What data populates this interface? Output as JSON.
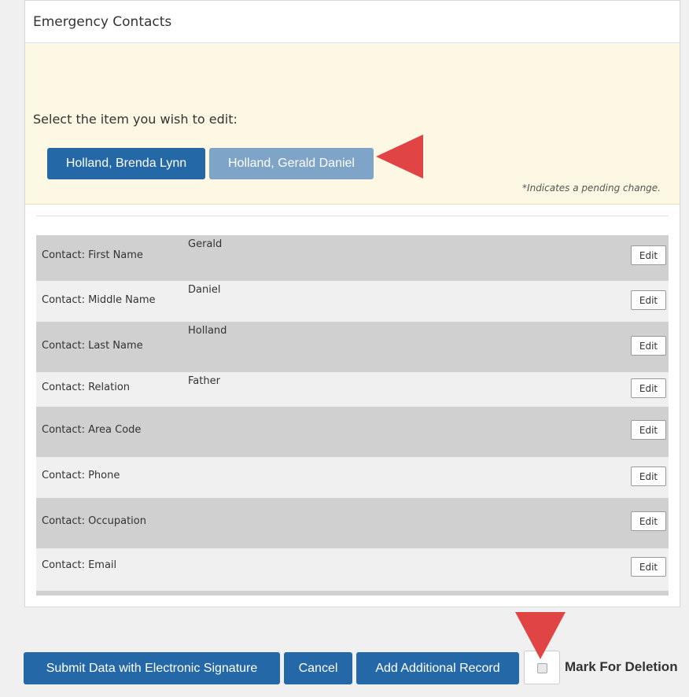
{
  "panel": {
    "title": "Emergency Contacts"
  },
  "selector": {
    "prompt": "Select the item you wish to edit:",
    "contacts": [
      {
        "label": "Holland, Brenda Lynn",
        "state": "active"
      },
      {
        "label": "Holland, Gerald Daniel",
        "state": "selected"
      }
    ],
    "pending_note": "*Indicates a pending change."
  },
  "fields": {
    "edit_label": "Edit",
    "rows": [
      {
        "label": "Contact: First Name",
        "value": "Gerald"
      },
      {
        "label": "Contact: Middle Name",
        "value": "Daniel"
      },
      {
        "label": "Contact: Last Name",
        "value": "Holland"
      },
      {
        "label": "Contact: Relation",
        "value": "Father"
      },
      {
        "label": "Contact: Area Code",
        "value": ""
      },
      {
        "label": "Contact: Phone",
        "value": ""
      },
      {
        "label": "Contact: Occupation",
        "value": ""
      },
      {
        "label": "Contact: Email",
        "value": ""
      }
    ]
  },
  "actions": {
    "submit_label": "Submit Data with Electronic Signature",
    "cancel_label": "Cancel",
    "add_label": "Add Additional Record",
    "mark_label": "Mark For Deletion",
    "mark_checked": false
  },
  "colors": {
    "primary": "#2468a8",
    "primary_muted": "#7ea4c8",
    "highlight_bg": "#fcf8e3",
    "annotation_arrow": "#e04444"
  },
  "annotations": [
    "red-arrow-pointing-left",
    "red-arrow-pointing-down"
  ]
}
